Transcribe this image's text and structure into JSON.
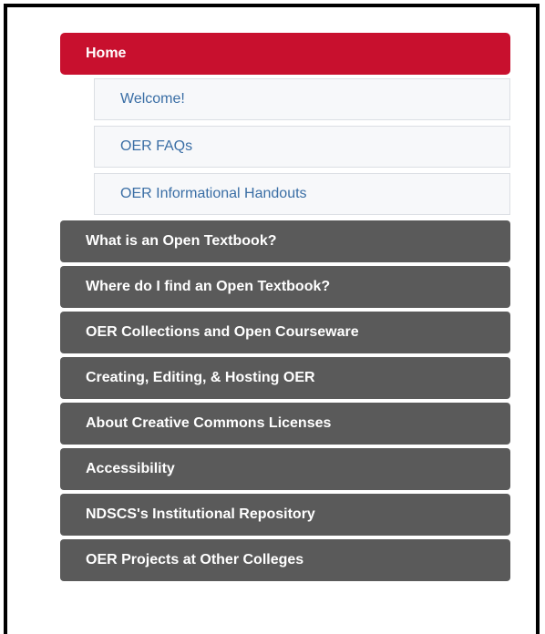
{
  "nav": {
    "home_label": "Home",
    "sub_items": [
      {
        "label": "Welcome!"
      },
      {
        "label": "OER FAQs"
      },
      {
        "label": "OER Informational Handouts"
      }
    ],
    "sections": [
      {
        "label": "What is an Open Textbook?"
      },
      {
        "label": "Where do I find an Open Textbook?"
      },
      {
        "label": "OER Collections and Open Courseware"
      },
      {
        "label": "Creating, Editing, & Hosting OER"
      },
      {
        "label": "About Creative Commons Licenses"
      },
      {
        "label": "Accessibility"
      },
      {
        "label": "NDSCS's Institutional Repository"
      },
      {
        "label": "OER Projects at Other Colleges"
      }
    ]
  },
  "colors": {
    "active": "#c8102e",
    "section": "#5a5a5a",
    "link": "#3a6ea5",
    "frame_border": "#000000"
  }
}
